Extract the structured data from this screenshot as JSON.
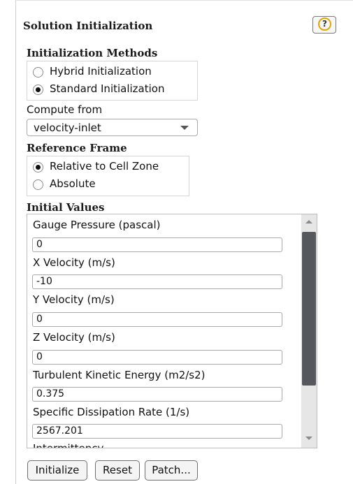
{
  "panel": {
    "title": "Solution Initialization",
    "help_symbol": "?"
  },
  "init_methods": {
    "heading": "Initialization Methods",
    "options": [
      {
        "label": "Hybrid  Initialization",
        "selected": false
      },
      {
        "label": "Standard Initialization",
        "selected": true
      }
    ]
  },
  "compute_from": {
    "label": "Compute from",
    "value": "velocity-inlet"
  },
  "reference_frame": {
    "heading": "Reference Frame",
    "options": [
      {
        "label": "Relative to Cell Zone",
        "selected": true
      },
      {
        "label": "Absolute",
        "selected": false
      }
    ]
  },
  "initial_values": {
    "heading": "Initial Values",
    "fields": [
      {
        "label": "Gauge Pressure (pascal)",
        "value": "0"
      },
      {
        "label": "X Velocity (m/s)",
        "value": "-10"
      },
      {
        "label": "Y Velocity (m/s)",
        "value": "0"
      },
      {
        "label": "Z Velocity (m/s)",
        "value": "0"
      },
      {
        "label": "Turbulent Kinetic Energy (m2/s2)",
        "value": "0.375"
      },
      {
        "label": "Specific Dissipation Rate (1/s)",
        "value": "2567.201"
      },
      {
        "label": "Intermittency",
        "value": ""
      }
    ]
  },
  "buttons": {
    "initialize": "Initialize",
    "reset": "Reset",
    "patch": "Patch..."
  },
  "colors": {
    "help_ring": "#e6a600",
    "scroll_thumb": "#55595e"
  }
}
